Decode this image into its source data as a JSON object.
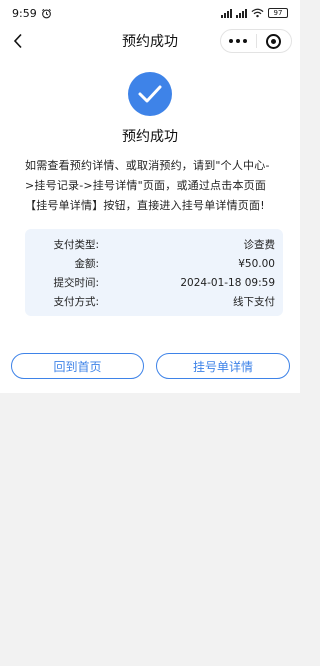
{
  "status_bar": {
    "time": "9:59",
    "battery": "97"
  },
  "nav": {
    "title": "预约成功"
  },
  "result": {
    "title": "预约成功",
    "hint": "如需查看预约详情、或取消预约，请到\"个人中心->挂号记录->挂号详情\"页面，或通过点击本页面【挂号单详情】按钮，直接进入挂号单详情页面!"
  },
  "info": {
    "rows": [
      {
        "label": "支付类型:",
        "value": "诊查费"
      },
      {
        "label": "金额:",
        "value": "¥50.00"
      },
      {
        "label": "提交时间:",
        "value": "2024-01-18 09:59"
      },
      {
        "label": "支付方式:",
        "value": "线下支付"
      }
    ]
  },
  "actions": {
    "home_label": "回到首页",
    "detail_label": "挂号单详情"
  },
  "colors": {
    "accent": "#3e83e8",
    "card_bg": "#eef4fc"
  },
  "icons": {
    "back": "chevron-left-icon",
    "more": "more-dots-icon",
    "close": "target-icon",
    "success": "check-icon",
    "alarm": "alarm-clock-icon",
    "wifi": "wifi-icon"
  }
}
